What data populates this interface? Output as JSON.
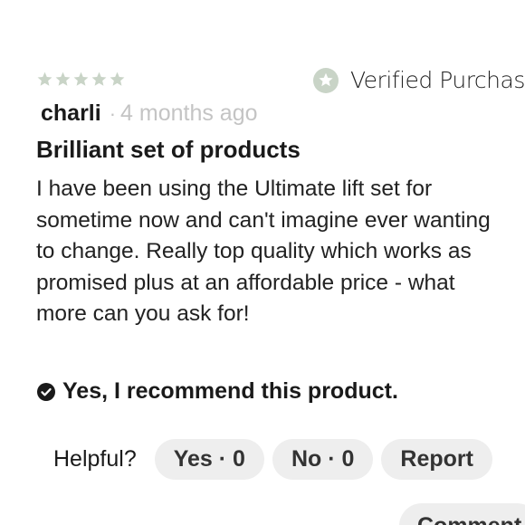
{
  "review": {
    "rating": 5,
    "rating_max": 5,
    "star_color": "#c9d4c7",
    "verified_label": "Verified Purchase",
    "verified_icon": "star-badge-icon",
    "author": "charli",
    "separator": "·",
    "time_ago": "4 months ago",
    "title": "Brilliant set of products",
    "body": "I have been using the Ultimate lift set for sometime now and can't imagine ever wanting to change. Really top quality which works as promised plus at an affordable price - what more can you ask for!",
    "recommend_text": "Yes, I recommend this product.",
    "recommend_icon": "check-circle-icon"
  },
  "actions": {
    "helpful_label": "Helpful?",
    "yes_label": "Yes · 0",
    "no_label": "No · 0",
    "report_label": "Report",
    "comment_label": "Comment"
  }
}
